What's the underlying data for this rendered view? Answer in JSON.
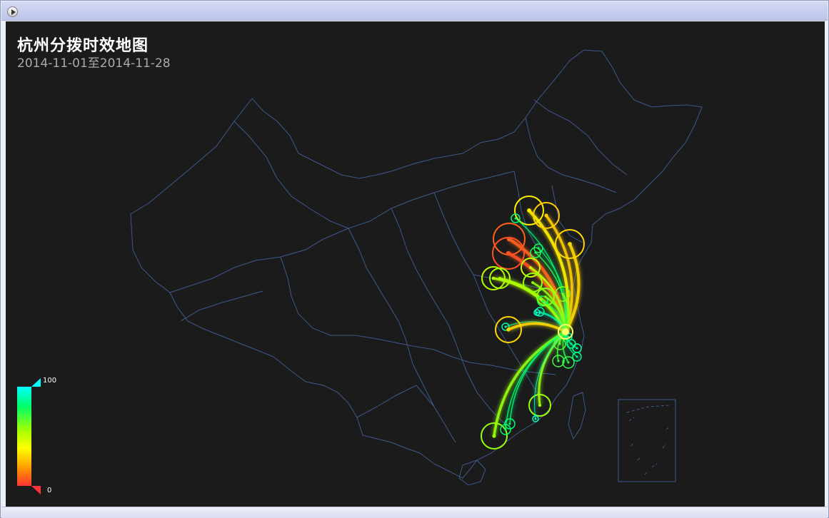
{
  "window": {
    "play_icon": "play-icon"
  },
  "map": {
    "title": "杭州分拨时效地图",
    "subtitle": "2014-11-01至2014-11-28",
    "background": "#1b1b1b",
    "border_color": "#3d5a8a",
    "hub": {
      "color": "#ffff66"
    },
    "legend": {
      "max": "100",
      "min": "0",
      "colors": [
        "#00ffff",
        "#00ff66",
        "#aaff00",
        "#ffff00",
        "#ff9900",
        "#ff3333"
      ]
    },
    "routes": [
      {
        "value": 35,
        "size": 20
      },
      {
        "value": 28,
        "size": 18
      },
      {
        "value": 30,
        "size": 20
      },
      {
        "value": 8,
        "size": 22
      },
      {
        "value": 5,
        "size": 22
      },
      {
        "value": 52,
        "size": 16
      },
      {
        "value": 55,
        "size": 14
      },
      {
        "value": 50,
        "size": 13
      },
      {
        "value": 58,
        "size": 13
      },
      {
        "value": 80,
        "size": 7
      },
      {
        "value": 85,
        "size": 6
      },
      {
        "value": 78,
        "size": 6
      },
      {
        "value": 82,
        "size": 6
      },
      {
        "value": 75,
        "size": 7
      },
      {
        "value": 88,
        "size": 5
      },
      {
        "value": 60,
        "size": 10
      },
      {
        "value": 90,
        "size": 5
      },
      {
        "value": 84,
        "size": 6
      },
      {
        "value": 86,
        "size": 6
      },
      {
        "value": 83,
        "size": 6
      },
      {
        "value": 30,
        "size": 18
      },
      {
        "value": 58,
        "size": 18
      },
      {
        "value": 57,
        "size": 15
      },
      {
        "value": 80,
        "size": 7
      },
      {
        "value": 82,
        "size": 7
      },
      {
        "value": 92,
        "size": 4
      },
      {
        "value": 70,
        "size": 8
      },
      {
        "value": 74,
        "size": 8
      },
      {
        "value": 66,
        "size": 8
      },
      {
        "value": 95,
        "size": 4
      },
      {
        "value": 60,
        "size": 12
      }
    ]
  }
}
